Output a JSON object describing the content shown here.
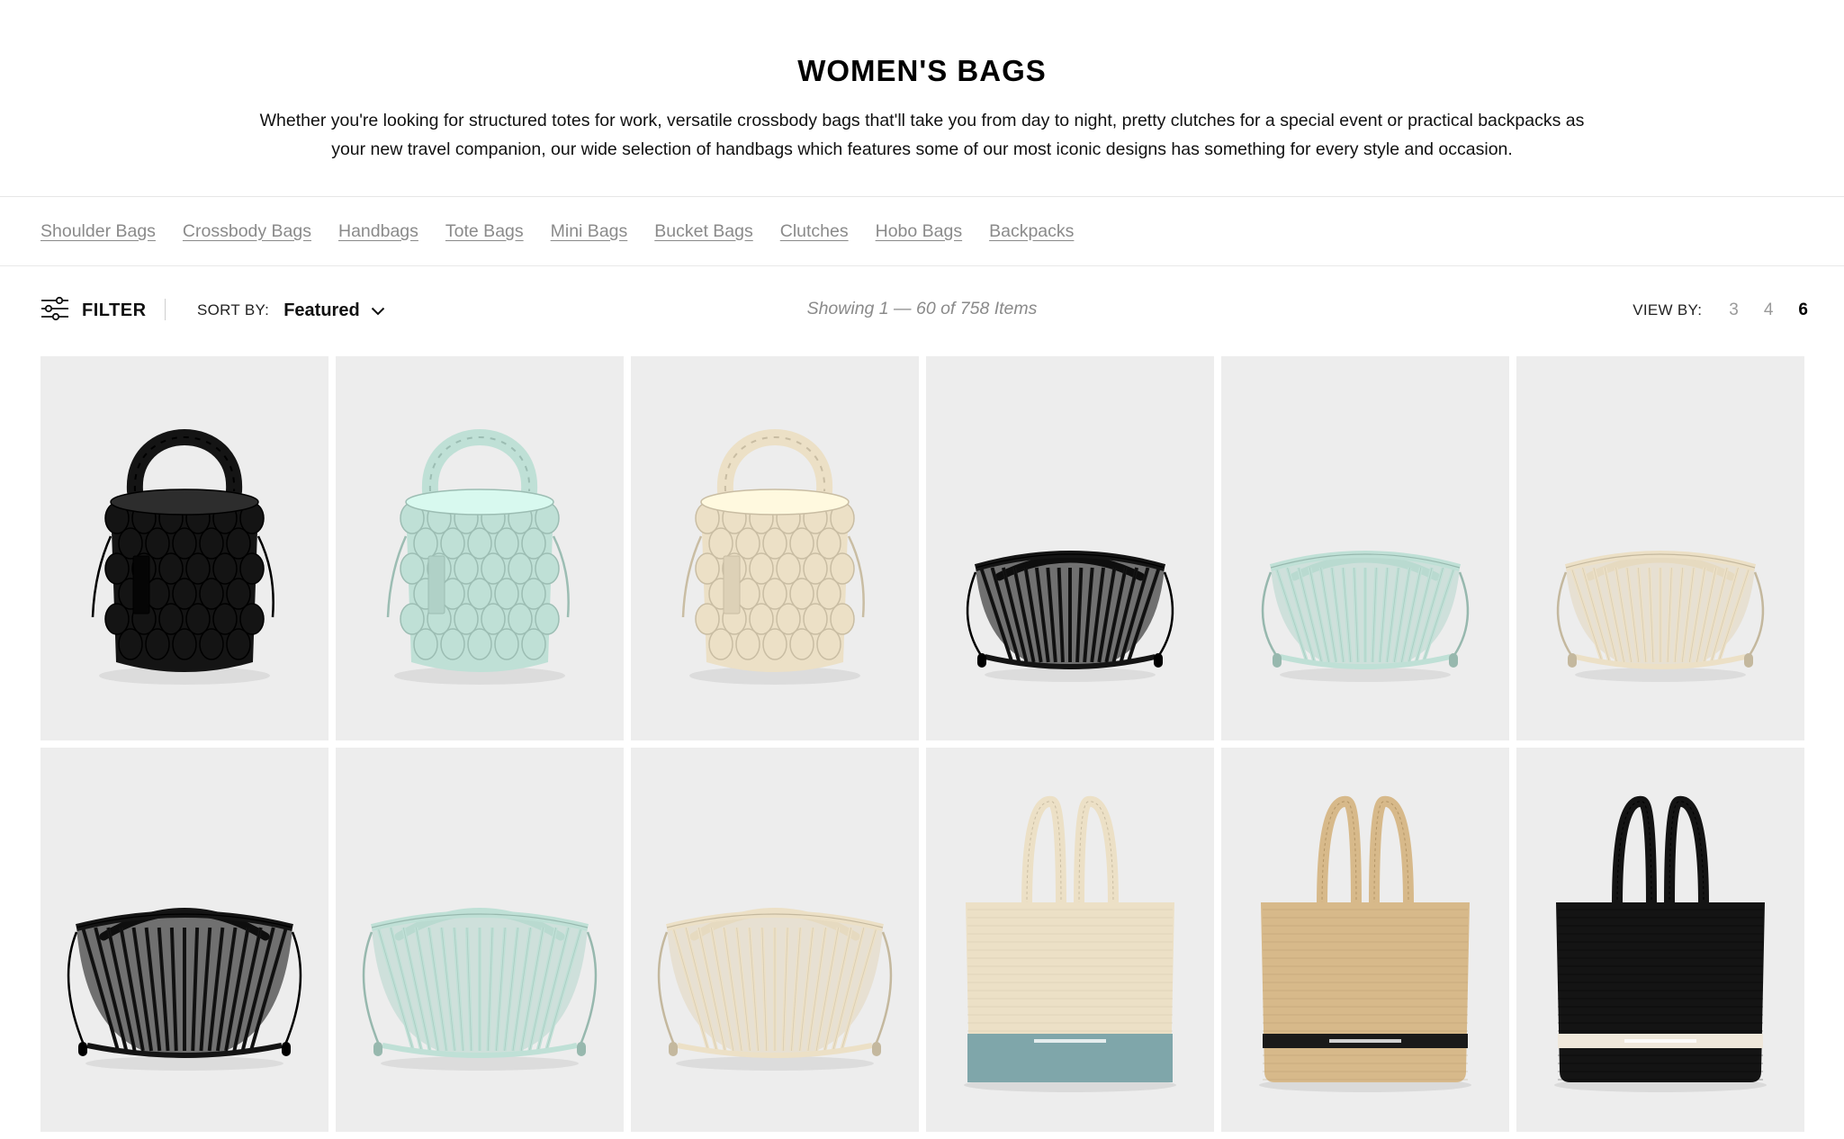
{
  "page": {
    "title": "WOMEN'S BAGS",
    "description": "Whether you're looking for structured totes for work, versatile crossbody bags that'll take you from day to night, pretty clutches for a special event or practical backpacks as your new travel companion, our wide selection of handbags which features some of our most iconic designs has something for every style and occasion."
  },
  "categories": [
    "Shoulder Bags",
    "Crossbody Bags",
    "Handbags",
    "Tote Bags",
    "Mini Bags",
    "Bucket Bags",
    "Clutches",
    "Hobo Bags",
    "Backpacks"
  ],
  "toolbar": {
    "filter_label": "FILTER",
    "sort_label": "SORT BY:",
    "sort_value": "Featured",
    "count_text": "Showing 1 — 60 of 758 Items",
    "view_label": "VIEW BY:",
    "view_options": [
      "3",
      "4",
      "6"
    ],
    "view_selected": "6"
  },
  "colors": {
    "black": "#141414",
    "mint": "#bfe0d6",
    "cream": "#ece0c6",
    "natural": "#d7b98a",
    "card_bg": "#ededed"
  },
  "products": [
    {
      "style": "bucket",
      "color": "black"
    },
    {
      "style": "bucket",
      "color": "mint"
    },
    {
      "style": "bucket",
      "color": "cream"
    },
    {
      "style": "cage",
      "color": "black"
    },
    {
      "style": "cage",
      "color": "mint"
    },
    {
      "style": "cage",
      "color": "cream"
    },
    {
      "style": "cage-large",
      "color": "black"
    },
    {
      "style": "cage-large",
      "color": "mint"
    },
    {
      "style": "cage-large",
      "color": "cream"
    },
    {
      "style": "tote",
      "color": "cream",
      "stripe": "#7fa6aa"
    },
    {
      "style": "tote",
      "color": "natural",
      "stripe": "#1a1a1a"
    },
    {
      "style": "tote",
      "color": "black",
      "stripe": "#efe7da"
    }
  ]
}
